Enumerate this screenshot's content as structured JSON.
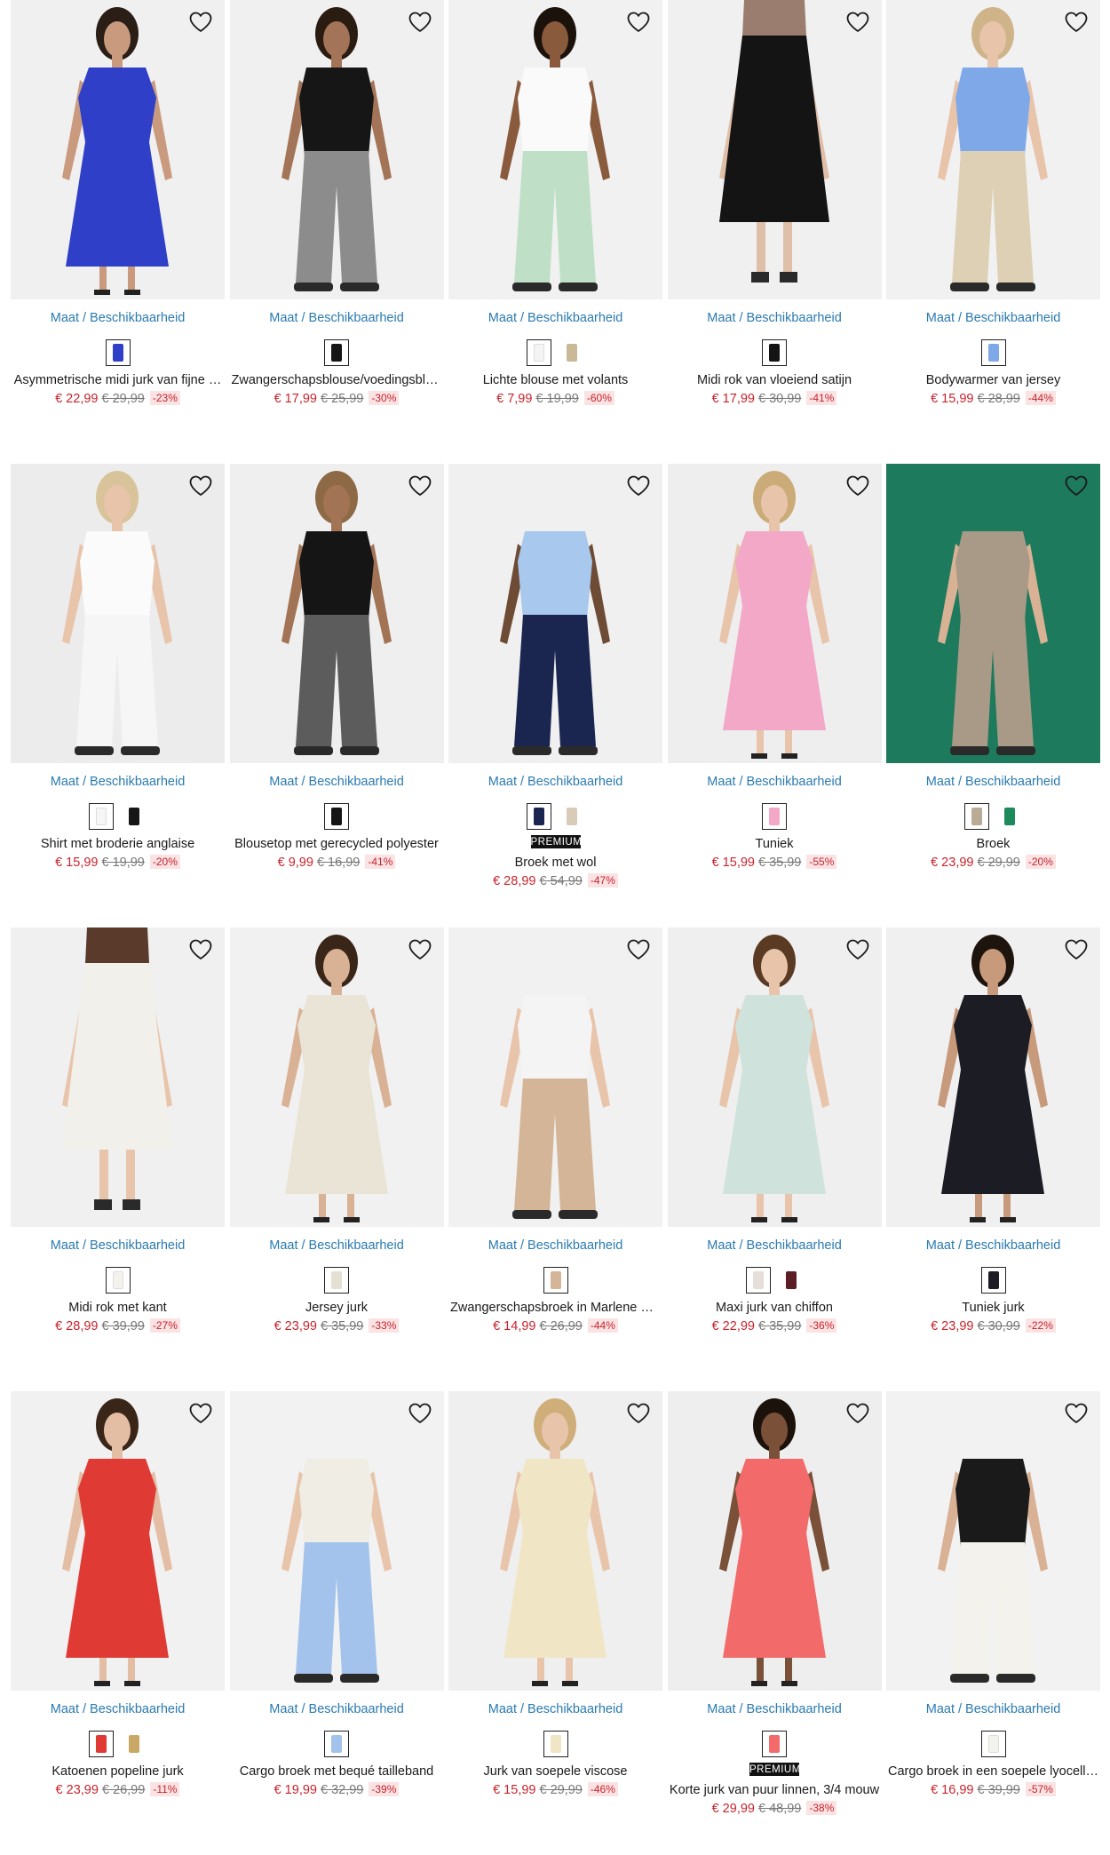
{
  "size_link_label": "Maat / Beschikbaarheid",
  "premium_label": "PREMIUM",
  "products": [
    {
      "name": "Asymmetrische midi jurk van fijne …",
      "price": "€ 22,99",
      "old_price": "€ 29,99",
      "discount": "-23%",
      "premium": false,
      "bg": "#f0f0f0",
      "top": "#2f3fc8",
      "bottom": "#2f3fc8",
      "skin": "#c99a7e",
      "hair": "#2a1e16",
      "style": "dress",
      "swatches": [
        "#2f3fc8"
      ]
    },
    {
      "name": "Zwangerschapsblouse/voedingsblo…",
      "price": "€ 17,99",
      "old_price": "€ 25,99",
      "discount": "-30%",
      "premium": false,
      "bg": "#f0f0f0",
      "top": "#161616",
      "bottom": "#8c8c8c",
      "skin": "#a37457",
      "hair": "#2b1c12",
      "style": "pants",
      "swatches": [
        "#161616"
      ]
    },
    {
      "name": "Lichte blouse met volants",
      "price": "€ 7,99",
      "old_price": "€ 19,99",
      "discount": "-60%",
      "premium": false,
      "bg": "#f1f1f1",
      "top": "#fafafa",
      "bottom": "#bfe0c6",
      "skin": "#8a5a3d",
      "hair": "#1c120c",
      "style": "pants",
      "swatches": [
        "#f4f4f4",
        "#c9b996"
      ]
    },
    {
      "name": "Midi rok van vloeiend satijn",
      "price": "€ 17,99",
      "old_price": "€ 30,99",
      "discount": "-41%",
      "premium": false,
      "bg": "#f0f0f0",
      "top": "#9b7d70",
      "bottom": "#141414",
      "skin": "#e0bfa8",
      "hair": "#00000000",
      "style": "skirt",
      "swatches": [
        "#141414"
      ]
    },
    {
      "name": "Bodywarmer van jersey",
      "price": "€ 15,99",
      "old_price": "€ 28,99",
      "discount": "-44%",
      "premium": false,
      "bg": "#f1f1f1",
      "top": "#7fa8e8",
      "bottom": "#ddd0b4",
      "skin": "#e8c4ab",
      "hair": "#cfb48a",
      "style": "pants",
      "swatches": [
        "#7fa8e8"
      ]
    },
    {
      "name": "Shirt met broderie anglaise",
      "price": "€ 15,99",
      "old_price": "€ 19,99",
      "discount": "-20%",
      "premium": false,
      "bg": "#ececec",
      "top": "#fbfbfb",
      "bottom": "#f6f6f6",
      "skin": "#e8c4ab",
      "hair": "#d9c39a",
      "style": "pants",
      "swatches": [
        "#f6f6f6",
        "#161616"
      ]
    },
    {
      "name": "Blousetop met gerecycled polyester",
      "price": "€ 9,99",
      "old_price": "€ 16,99",
      "discount": "-41%",
      "premium": false,
      "bg": "#efefef",
      "top": "#151515",
      "bottom": "#5c5c5c",
      "skin": "#a27455",
      "hair": "#8d6a45",
      "style": "pants",
      "swatches": [
        "#151515"
      ]
    },
    {
      "name": "Broek met wol",
      "price": "€ 28,99",
      "old_price": "€ 54,99",
      "discount": "-47%",
      "premium": true,
      "bg": "#f0f0f0",
      "top": "#a8c8ee",
      "bottom": "#1a2550",
      "skin": "#6e4b34",
      "hair": "#00000000",
      "style": "pants",
      "swatches": [
        "#1a2550",
        "#d8ccb8"
      ]
    },
    {
      "name": "Tuniek",
      "price": "€ 15,99",
      "old_price": "€ 35,99",
      "discount": "-55%",
      "premium": false,
      "bg": "#eeeeee",
      "top": "#f2a8c6",
      "bottom": "#f2a8c6",
      "skin": "#e8c4ab",
      "hair": "#cbab78",
      "style": "dress",
      "swatches": [
        "#f2a8c6"
      ]
    },
    {
      "name": "Broek",
      "price": "€ 23,99",
      "old_price": "€ 29,99",
      "discount": "-20%",
      "premium": false,
      "bg": "#1d7a5c",
      "top": "#a89a86",
      "bottom": "#a89a86",
      "skin": "#d9b195",
      "hair": "#00000000",
      "style": "pants",
      "swatches": [
        "#b9ab95",
        "#1d8a5c"
      ]
    },
    {
      "name": "Midi rok met kant",
      "price": "€ 28,99",
      "old_price": "€ 39,99",
      "discount": "-27%",
      "premium": false,
      "bg": "#f0f0f0",
      "top": "#5a3a2a",
      "bottom": "#f2f0ea",
      "skin": "#e8c4ab",
      "hair": "#00000000",
      "style": "skirt",
      "swatches": [
        "#f4f2ec"
      ]
    },
    {
      "name": "Jersey jurk",
      "price": "€ 23,99",
      "old_price": "€ 35,99",
      "discount": "-33%",
      "premium": false,
      "bg": "#f1f1f1",
      "top": "#e9e4d6",
      "bottom": "#e9e4d6",
      "skin": "#d9b195",
      "hair": "#3a2618",
      "style": "dress",
      "swatches": [
        "#e4e0d4"
      ]
    },
    {
      "name": "Zwangerschapsbroek in Marlene Di…",
      "price": "€ 14,99",
      "old_price": "€ 26,99",
      "discount": "-44%",
      "premium": false,
      "bg": "#f1f1f1",
      "top": "#f4f4f4",
      "bottom": "#d4b597",
      "skin": "#e8c4ab",
      "hair": "#00000000",
      "style": "pants",
      "swatches": [
        "#d4b597"
      ]
    },
    {
      "name": "Maxi jurk van chiffon",
      "price": "€ 22,99",
      "old_price": "€ 35,99",
      "discount": "-36%",
      "premium": false,
      "bg": "#efefef",
      "top": "#cfe2dc",
      "bottom": "#cfe2dc",
      "skin": "#e8c4ab",
      "hair": "#5a3a22",
      "style": "dress",
      "swatches": [
        "#e6ded8",
        "#5a1e24"
      ]
    },
    {
      "name": "Tuniek jurk",
      "price": "€ 23,99",
      "old_price": "€ 30,99",
      "discount": "-22%",
      "premium": false,
      "bg": "#f0f0f0",
      "top": "#1c1c24",
      "bottom": "#1c1c24",
      "skin": "#c79a7c",
      "hair": "#1e140e",
      "style": "dress",
      "swatches": [
        "#1c1c24"
      ]
    },
    {
      "name": "Katoenen popeline jurk",
      "price": "€ 23,99",
      "old_price": "€ 26,99",
      "discount": "-11%",
      "premium": false,
      "bg": "#f1f1f1",
      "top": "#e03a34",
      "bottom": "#e03a34",
      "skin": "#e4bea4",
      "hair": "#3a2618",
      "style": "dress",
      "swatches": [
        "#e03a34",
        "#c9a866"
      ]
    },
    {
      "name": "Cargo broek met bequé tailleband",
      "price": "€ 19,99",
      "old_price": "€ 32,99",
      "discount": "-39%",
      "premium": false,
      "bg": "#f2f2f2",
      "top": "#f0ede4",
      "bottom": "#a3c3ec",
      "skin": "#e8c4ab",
      "hair": "#00000000",
      "style": "pants",
      "swatches": [
        "#a3c3ec"
      ]
    },
    {
      "name": "Jurk van soepele viscose",
      "price": "€ 15,99",
      "old_price": "€ 29,99",
      "discount": "-46%",
      "premium": false,
      "bg": "#efefef",
      "top": "#f0e6c6",
      "bottom": "#f0e6c6",
      "skin": "#e8c4ab",
      "hair": "#cfae7a",
      "style": "dress",
      "swatches": [
        "#f0e6c6"
      ]
    },
    {
      "name": "Korte jurk van puur linnen, 3/4 mouw",
      "price": "€ 29,99",
      "old_price": "€ 48,99",
      "discount": "-38%",
      "premium": true,
      "bg": "#eeeeee",
      "top": "#f26a6a",
      "bottom": "#f26a6a",
      "skin": "#7a5039",
      "hair": "#1c120c",
      "style": "dress",
      "swatches": [
        "#f26a6a"
      ]
    },
    {
      "name": "Cargo broek in een soepele lyocell…",
      "price": "€ 16,99",
      "old_price": "€ 39,99",
      "discount": "-57%",
      "premium": false,
      "bg": "#f2f2f2",
      "top": "#1a1a1a",
      "bottom": "#f4f2ec",
      "skin": "#d9b195",
      "hair": "#00000000",
      "style": "pants",
      "swatches": [
        "#f4f2ec"
      ]
    }
  ]
}
